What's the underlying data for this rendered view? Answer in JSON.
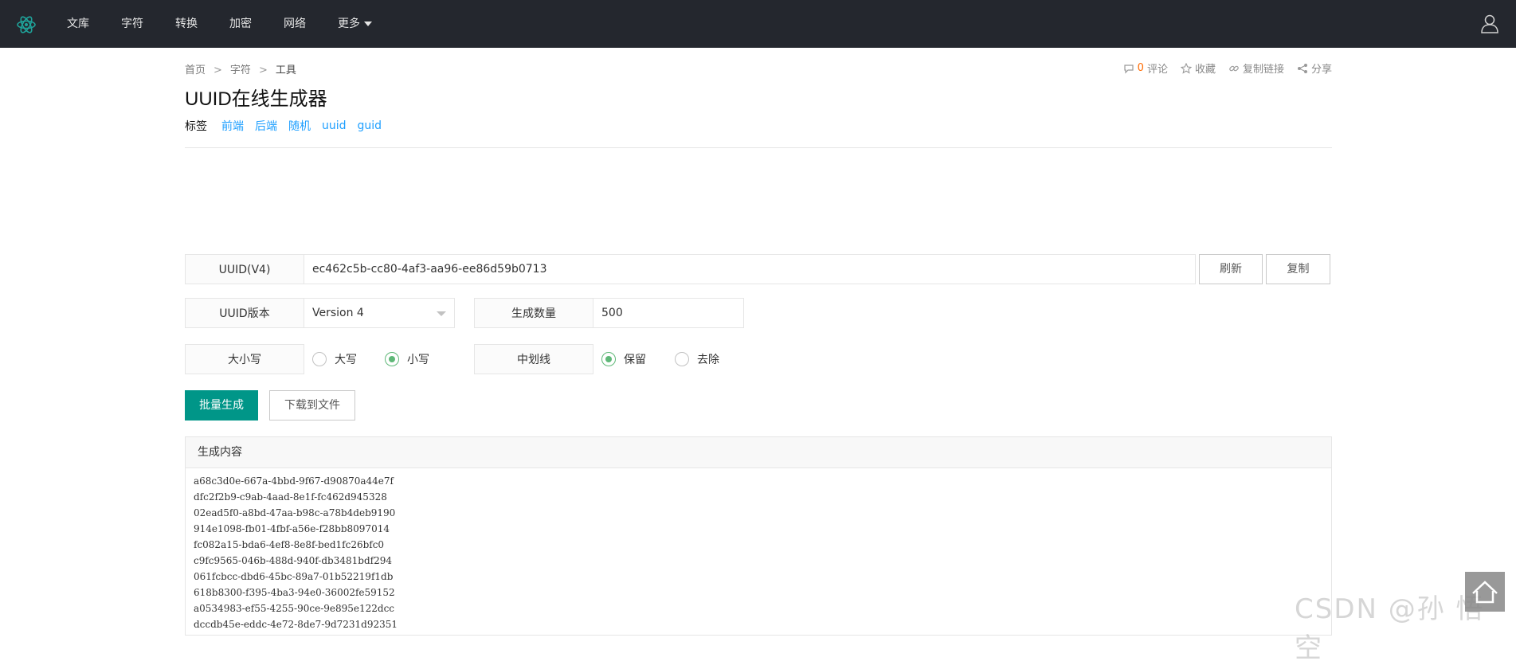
{
  "nav": {
    "items": [
      "文库",
      "字符",
      "转换",
      "加密",
      "网络",
      "更多"
    ]
  },
  "breadcrumb": {
    "home": "首页",
    "sep": ">",
    "category": "字符",
    "current": "工具"
  },
  "actions": {
    "comment_count": "0",
    "comment": "评论",
    "favorite": "收藏",
    "copy_link": "复制链接",
    "share": "分享"
  },
  "page": {
    "title": "UUID在线生成器",
    "tags_label": "标签",
    "tags": [
      "前端",
      "后端",
      "随机",
      "uuid",
      "guid"
    ]
  },
  "form": {
    "uuid_label": "UUID(V4)",
    "uuid_value": "ec462c5b-cc80-4af3-aa96-ee86d59b0713",
    "refresh": "刷新",
    "copy": "复制",
    "version_label": "UUID版本",
    "version_value": "Version 4",
    "count_label": "生成数量",
    "count_value": "500",
    "case_label": "大小写",
    "case_upper": "大写",
    "case_lower": "小写",
    "case_selected": "lower",
    "dash_label": "中划线",
    "dash_keep": "保留",
    "dash_remove": "去除",
    "dash_selected": "keep",
    "batch_generate": "批量生成",
    "download": "下载到文件"
  },
  "output": {
    "header": "生成内容",
    "lines": [
      "a68c3d0e-667a-4bbd-9f67-d90870a44e7f",
      "dfc2f2b9-c9ab-4aad-8e1f-fc462d945328",
      "02ead5f0-a8bd-47aa-b98c-a78b4deb9190",
      "914e1098-fb01-4fbf-a56e-f28bb8097014",
      "fc082a15-bda6-4ef8-8e8f-bed1fc26bfc0",
      "c9fc9565-046b-488d-940f-db3481bdf294",
      "061fcbcc-dbd6-45bc-89a7-01b52219f1db",
      "618b8300-f395-4ba3-94e0-36002fe59152",
      "a0534983-ef55-4255-90ce-9e895e122dcc",
      "dccdb45e-eddc-4e72-8de7-9d7231d92351"
    ]
  },
  "watermark": "CSDN @孙 悟 空",
  "colors": {
    "nav_bg": "#24272e",
    "primary": "#009688",
    "tag": "#1e9fff",
    "radio_on": "#5fb878",
    "comment_count": "#ff6a00"
  },
  "icons": [
    "logo-icon",
    "caret-down-icon",
    "user-icon",
    "comment-icon",
    "star-icon",
    "link-icon",
    "share-icon",
    "back-to-top-icon"
  ]
}
